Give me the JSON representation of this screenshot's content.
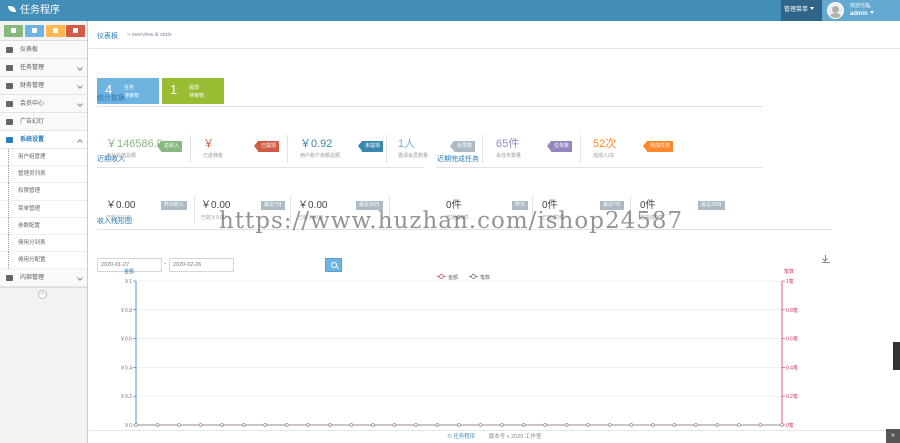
{
  "app": {
    "title": "任务程序"
  },
  "header": {
    "menu_label": "管理菜单",
    "welcome": "欢迎光临,",
    "username": "admin"
  },
  "colors": {
    "topbar": "#438eb9",
    "shortcut_green": "#87b87f",
    "shortcut_blue": "#6fb3e0",
    "shortcut_yellow": "#ffb752",
    "shortcut_red": "#d15b47",
    "tile_blue": "#6fb3e0",
    "tile_green": "#9abc32"
  },
  "sidebar": {
    "items": [
      {
        "label": "仪表板",
        "icon": "dashboard-icon",
        "has_children": false
      },
      {
        "label": "任务管理",
        "icon": "flag-icon",
        "has_children": true
      },
      {
        "label": "财务管理",
        "icon": "money-icon",
        "has_children": true
      },
      {
        "label": "会员中心",
        "icon": "user-icon",
        "has_children": true
      },
      {
        "label": "广告幻灯",
        "icon": "picture-icon",
        "has_children": false
      },
      {
        "label": "系统设置",
        "icon": "cog-icon",
        "has_children": true,
        "active": true
      },
      {
        "label": "内部管理",
        "icon": "briefcase-icon",
        "has_children": true
      }
    ],
    "sub_items": [
      "用户组管理",
      "管理员列表",
      "权限管理",
      "菜单管理",
      "参数配置",
      "佣用分到表",
      "佣用分配置"
    ],
    "collapse_glyph": "«"
  },
  "breadcrumb": {
    "title": "仪表板",
    "sub": "» overview & stats"
  },
  "tiles": [
    {
      "num": "4",
      "line1": "任务",
      "line2": "待审核"
    },
    {
      "num": "1",
      "line1": "提现",
      "line2": "待审核"
    }
  ],
  "stats": {
    "title": "统计数据",
    "items": [
      {
        "value": "￥146586.0",
        "caption": "平台充值总额",
        "badge": "总收入",
        "color": "#87b87f"
      },
      {
        "value": "￥",
        "caption": "已返佣金",
        "badge": "已提现",
        "color": "#d15b47"
      },
      {
        "value": "￥0.92",
        "caption": "用户账户余额总额",
        "badge": "未提现",
        "color": "#3a87ad"
      },
      {
        "value": "1人",
        "caption": "邀请会员数量",
        "badge": "会员数",
        "color": "#abbac3"
      },
      {
        "value": "65件",
        "caption": "会任务数量",
        "badge": "任务数",
        "color": "#9585bf"
      },
      {
        "value": "52次",
        "caption": "完成人/次",
        "badge": "完成任务",
        "color": "#ff892a"
      }
    ]
  },
  "income": {
    "title": "近期收入",
    "items": [
      {
        "value": "￥0.00",
        "caption": "已收￥0.00",
        "tag": "昨日收入"
      },
      {
        "value": "￥0.00",
        "caption": "已收￥0.00",
        "tag": "最近7日"
      },
      {
        "value": "￥0.00",
        "caption": "已收￥0.00",
        "tag": "最近30日"
      }
    ]
  },
  "tasks": {
    "title": "近期完成任务",
    "items": [
      {
        "value": "0件",
        "caption": "已完成0件",
        "tag": "昨日"
      },
      {
        "value": "0件",
        "caption": "已完成0件",
        "tag": "最近7日"
      },
      {
        "value": "0件",
        "caption": "已完成0件",
        "tag": "最近30日"
      }
    ]
  },
  "income_chart": {
    "title": "收入线形图",
    "date_from": "2020-01-27",
    "date_sep": "-",
    "date_to": "2020-02-26"
  },
  "chart_data": {
    "type": "line",
    "left_axis_label": "金额",
    "right_axis_label": "笔数",
    "legend_position": "top-center",
    "series": [
      {
        "name": "金额",
        "color": "#e06c75",
        "axis": "left",
        "values": [
          0,
          0,
          0,
          0,
          0,
          0,
          0,
          0,
          0,
          0,
          0,
          0,
          0,
          0,
          0,
          0,
          0,
          0,
          0,
          0,
          0,
          0,
          0,
          0,
          0,
          0,
          0,
          0,
          0,
          0,
          0
        ]
      },
      {
        "name": "笔数",
        "color": "#8a8a8a",
        "axis": "right",
        "values": [
          0,
          0,
          0,
          0,
          0,
          0,
          0,
          0,
          0,
          0,
          0,
          0,
          0,
          0,
          0,
          0,
          0,
          0,
          0,
          0,
          0,
          0,
          0,
          0,
          0,
          0,
          0,
          0,
          0,
          0,
          0
        ]
      }
    ],
    "left_ticks": [
      "￥1",
      "￥0.8",
      "￥0.6",
      "￥0.4",
      "￥0.2",
      "￥0"
    ],
    "right_ticks": [
      "1笔",
      "0.8笔",
      "0.6笔",
      "0.4笔",
      "0.2笔",
      "0笔"
    ],
    "ylim_left": [
      0,
      1
    ],
    "ylim_right": [
      0,
      1
    ],
    "grid": true
  },
  "footer": {
    "brand": "© 任务程序",
    "version": "版本号 v 2020 工作室"
  },
  "watermark": "https://www.huzhan.com/ishop24587",
  "back_to_top_glyph": "»"
}
